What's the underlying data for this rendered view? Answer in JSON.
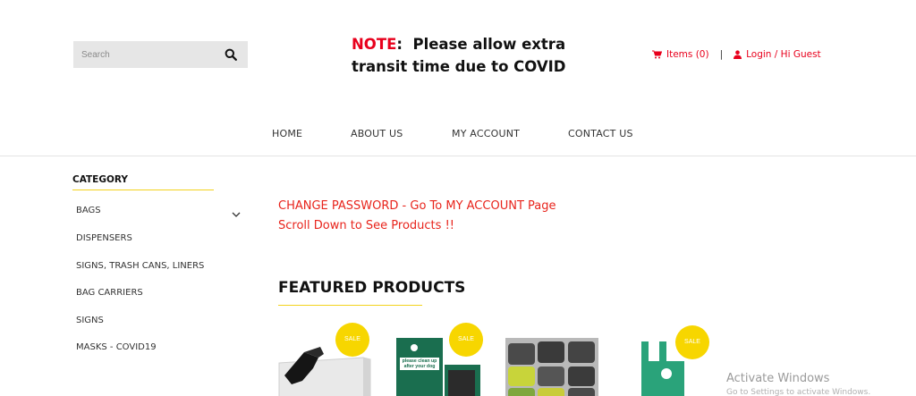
{
  "search": {
    "placeholder": "Search"
  },
  "notice": {
    "prefix": "NOTE",
    "colon": ":",
    "line1": "Please allow extra",
    "line2": "transit time due to COVID"
  },
  "account": {
    "items": "Items (0)",
    "separator": "|",
    "login": "Login / Hi Guest"
  },
  "nav": [
    "HOME",
    "ABOUT US",
    "MY ACCOUNT",
    "CONTACT US"
  ],
  "sidebar": {
    "title": "CATEGORY",
    "items": [
      "BAGS",
      "DISPENSERS",
      "SIGNS, TRASH CANS, LINERS",
      "BAG CARRIERS",
      "SIGNS",
      "MASKS - COVID19"
    ]
  },
  "main": {
    "message1": "CHANGE PASSWORD - Go To MY ACCOUNT Page",
    "message2": "Scroll Down to See Products !!",
    "featured_title": "FEATURED PRODUCTS",
    "sale_badge": "SALE",
    "product2_sign_line1": "please clean up",
    "product2_sign_line2": "after your dog"
  },
  "watermark": {
    "line1": "Activate Windows",
    "line2": "Go to Settings to activate Windows."
  },
  "colors": {
    "accent_red": "#e8001c",
    "accent_yellow": "#f7d600",
    "product_green": "#1a6e4f",
    "product_teal": "#2aa37a"
  }
}
